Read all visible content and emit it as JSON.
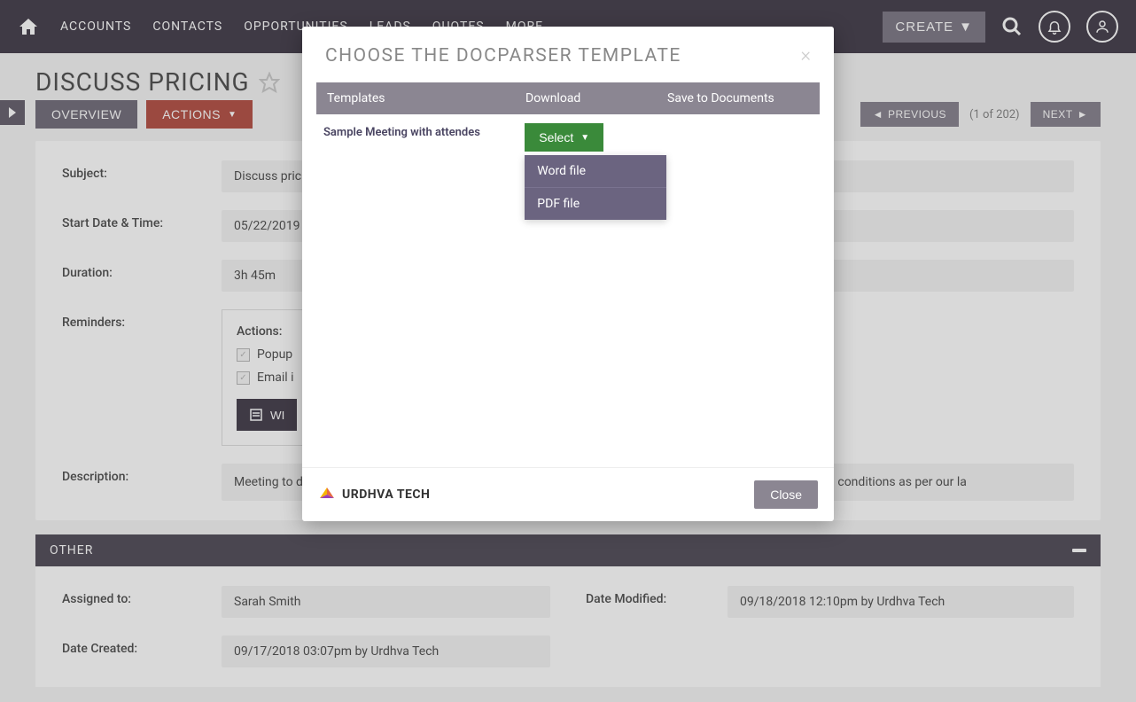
{
  "nav": {
    "items": [
      "ACCOUNTS",
      "CONTACTS",
      "OPPORTUNITIES",
      "LEADS",
      "QUOTES",
      "MORE"
    ],
    "create": "CREATE"
  },
  "page": {
    "title": "DISCUSS PRICING",
    "tabs": {
      "overview": "OVERVIEW",
      "actions": "ACTIONS"
    },
    "pager": {
      "prev": "PREVIOUS",
      "count": "(1 of 202)",
      "next": "NEXT"
    }
  },
  "fields": {
    "subject_label": "Subject:",
    "subject_value": "Discuss pricing",
    "start_label": "Start Date & Time:",
    "start_value": "05/22/2019",
    "duration_label": "Duration:",
    "duration_value": "3h 45m",
    "reminders_label": "Reminders:",
    "reminders": {
      "actions_label": "Actions:",
      "popup": "Popup",
      "email": "Email i",
      "wi": "WI"
    },
    "description_label": "Description:",
    "description_value": "Meeting to discuss project plan and hash out the details of implementation",
    "description_tail": "e system and pricing terms and conditions as per our la"
  },
  "other": {
    "header": "OTHER",
    "assigned_label": "Assigned to:",
    "assigned_value": "Sarah Smith",
    "modified_label": "Date Modified:",
    "modified_value": "09/18/2018 12:10pm by Urdhva Tech",
    "created_label": "Date Created:",
    "created_value": "09/17/2018 03:07pm by Urdhva Tech"
  },
  "modal": {
    "title": "CHOOSE THE DOCPARSER TEMPLATE",
    "headers": {
      "templates": "Templates",
      "download": "Download",
      "save": "Save to Documents"
    },
    "row": {
      "name": "Sample Meeting with attendes",
      "select": "Select"
    },
    "dropdown": {
      "word": "Word file",
      "pdf": "PDF file"
    },
    "footer_logo": "URDHVA TECH",
    "close": "Close"
  }
}
